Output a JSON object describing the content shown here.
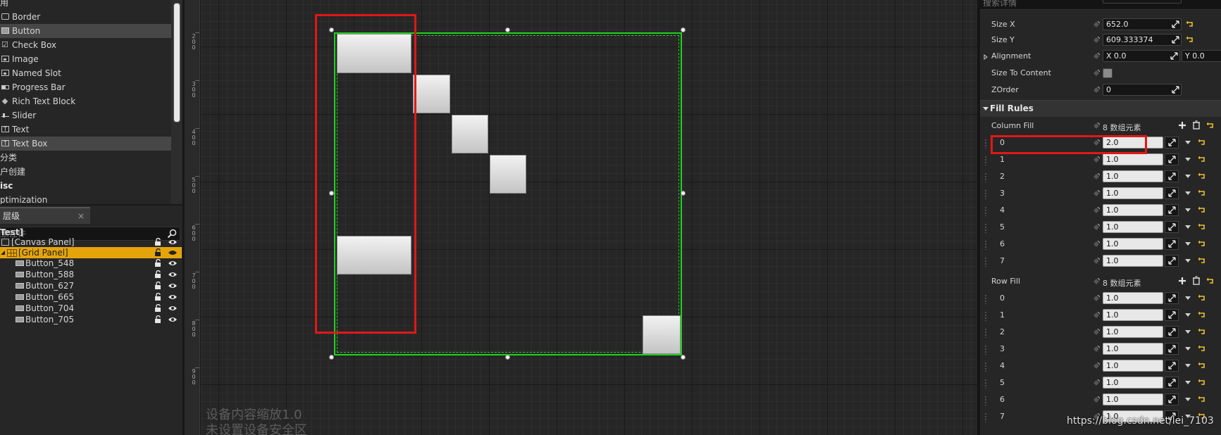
{
  "palette": {
    "items": [
      {
        "label": "用",
        "kind": "cat"
      },
      {
        "label": "Border",
        "icon": "border-icon"
      },
      {
        "label": "Button",
        "icon": "button-icon",
        "selected": true
      },
      {
        "label": "Check Box",
        "icon": "check-box-icon"
      },
      {
        "label": "Image",
        "icon": "image-icon"
      },
      {
        "label": "Named Slot",
        "icon": "named-slot-icon"
      },
      {
        "label": "Progress Bar",
        "icon": "progress-bar-icon"
      },
      {
        "label": "Rich Text Block",
        "icon": "rich-text-icon"
      },
      {
        "label": "Slider",
        "icon": "slider-icon"
      },
      {
        "label": "Text",
        "icon": "text-icon"
      },
      {
        "label": "Text Box",
        "icon": "text-box-icon",
        "selected": true
      },
      {
        "label": "分类",
        "kind": "cat"
      },
      {
        "label": "户创建",
        "kind": "cat"
      },
      {
        "label": "isc",
        "kind": "cat-bold"
      },
      {
        "label": "ptimization",
        "kind": "cat"
      }
    ]
  },
  "hierarchy": {
    "tab_label": "层级",
    "close_glyph": "×",
    "search_placeholder": "索控件",
    "root": "Test]",
    "canvas": "[Canvas Panel]",
    "grid": "[Grid Panel]",
    "buttons": [
      "Button_548",
      "Button_588",
      "Button_627",
      "Button_665",
      "Button_704",
      "Button_705"
    ]
  },
  "ruler": {
    "marks": [
      "200",
      "300",
      "400",
      "500",
      "600",
      "700",
      "800",
      "900"
    ]
  },
  "viewport": {
    "scale_text": "设备内容缩放1.0",
    "safe_zone_text": "未设置设备安全区"
  },
  "details": {
    "search_placeholder": "搜索详情",
    "size_x_label": "Size X",
    "size_x": "652.0",
    "size_y_label": "Size Y",
    "size_y": "609.333374",
    "alignment_label": "Alignment",
    "alignment_x": "X  0.0",
    "alignment_y": "Y  0.0",
    "size_to_content_label": "Size To Content",
    "zorder_label": "ZOrder",
    "zorder": "0",
    "fill_rules_label": "Fill Rules",
    "column_fill_label": "Column Fill",
    "column_fill_count": "8 数组元素",
    "column_fill": [
      {
        "index": "0",
        "value": "2.0"
      },
      {
        "index": "1",
        "value": "1.0"
      },
      {
        "index": "2",
        "value": "1.0"
      },
      {
        "index": "3",
        "value": "1.0"
      },
      {
        "index": "4",
        "value": "1.0"
      },
      {
        "index": "5",
        "value": "1.0"
      },
      {
        "index": "6",
        "value": "1.0"
      },
      {
        "index": "7",
        "value": "1.0"
      }
    ],
    "row_fill_label": "Row Fill",
    "row_fill_count": "8 数组元素",
    "row_fill": [
      {
        "index": "0",
        "value": "1.0"
      },
      {
        "index": "1",
        "value": "1.0"
      },
      {
        "index": "2",
        "value": "1.0"
      },
      {
        "index": "3",
        "value": "1.0"
      },
      {
        "index": "4",
        "value": "1.0"
      },
      {
        "index": "5",
        "value": "1.0"
      },
      {
        "index": "6",
        "value": "1.0"
      },
      {
        "index": "7",
        "value": "1.0"
      }
    ]
  },
  "watermark": "https://blog.csdn.net/lei_7103",
  "colors": {
    "selection_accent": "#e5a50a",
    "grid_outline": "#23d023",
    "highlight_box": "#e01818"
  }
}
